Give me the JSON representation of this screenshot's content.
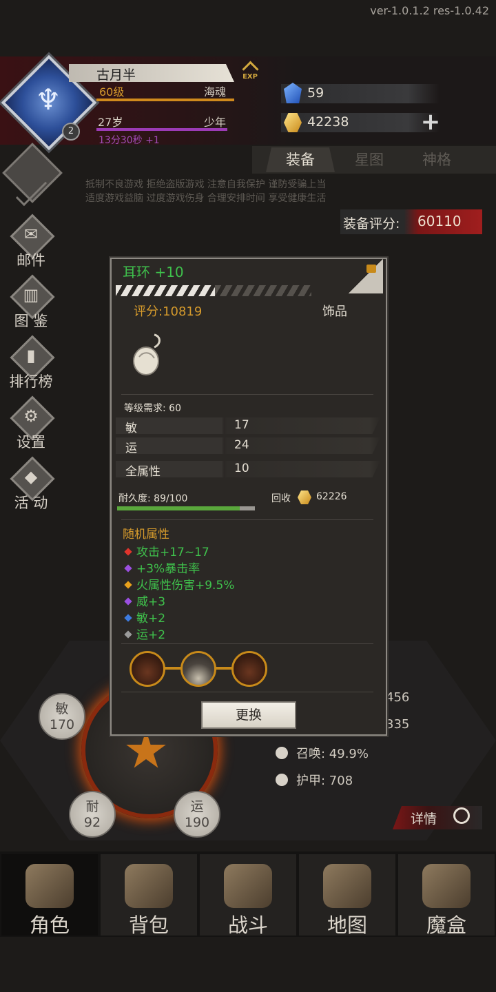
{
  "version": "ver-1.0.1.2  res-1.0.42",
  "player": {
    "name": "古月半",
    "level": "60级",
    "class": "海魂",
    "age": "27岁",
    "stage": "少年",
    "timer": "13分30秒 +1",
    "avatar_badge": "2",
    "exp_label": "EXP"
  },
  "currency": {
    "gems": "59",
    "gold": "42238"
  },
  "tabs": [
    "装备",
    "星图",
    "神格"
  ],
  "notice": [
    "抵制不良游戏 拒绝盗版游戏 注意自我保护 谨防受骗上当",
    "适度游戏益脑 过度游戏伤身 合理安排时间 享受健康生活"
  ],
  "equip_score": {
    "label": "装备评分:",
    "value": "60110"
  },
  "side_menu": [
    "邮件",
    "图 鉴",
    "排行榜",
    "设置",
    "活 动"
  ],
  "stat_coins": [
    {
      "name": "敏",
      "value": "170"
    },
    {
      "name": "耐",
      "value": "92"
    },
    {
      "name": "运",
      "value": "190"
    }
  ],
  "right_stats": [
    "456",
    "335",
    "召唤: 49.9%",
    "护甲: 708"
  ],
  "detail_label": "详情",
  "nav": [
    "角色",
    "背包",
    "战斗",
    "地图",
    "魔盒"
  ],
  "popup": {
    "title": "耳环 +10",
    "score": "评分:10819",
    "type": "饰品",
    "level_req": "等级需求: 60",
    "attributes": [
      {
        "name": "敏",
        "value": "17"
      },
      {
        "name": "运",
        "value": "24"
      },
      {
        "name": "全属性",
        "value": "10"
      }
    ],
    "durability_label": "耐久度: 89/100",
    "durability_fraction": 0.89,
    "recycle_label": "回收",
    "recycle_value": "62226",
    "random_title": "随机属性",
    "random_attrs": [
      {
        "text": "攻击+17~17",
        "color": "#e0342c"
      },
      {
        "text": "+3%暴击率",
        "color": "#9b4fe0"
      },
      {
        "text": "火属性伤害+9.5%",
        "color": "#e8a11c"
      },
      {
        "text": "威+3",
        "color": "#9b4fe0"
      },
      {
        "text": "敏+2",
        "color": "#3d7be0"
      },
      {
        "text": "运+2",
        "color": "#9a9a9a"
      }
    ],
    "replace_button": "更换"
  },
  "colors": {
    "green": "#3fc14c",
    "orange": "#d59a2c",
    "accent_red": "#a01e1e"
  }
}
